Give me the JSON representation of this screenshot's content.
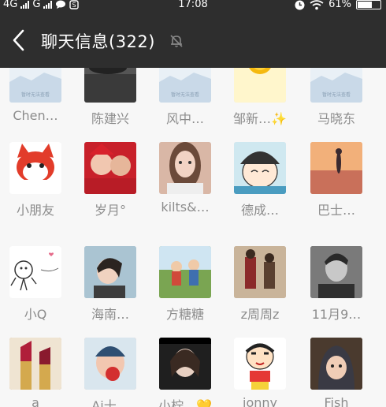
{
  "status_bar": {
    "network_left": "4G",
    "network_right": "G",
    "time": "17:08",
    "battery": "61%"
  },
  "header": {
    "title": "聊天信息(322)"
  },
  "placeholder_caption": "暂时无法查看",
  "rows": [
    {
      "members": [
        {
          "name": "Chen…",
          "avatar": "placeholder",
          "color": "#dbe6f0"
        },
        {
          "name": "陈建兴",
          "avatar": "photo-car",
          "color": "#3a3a3a"
        },
        {
          "name": "风中…",
          "avatar": "placeholder",
          "color": "#dbe6f0"
        },
        {
          "name": "邹新…✨",
          "avatar": "sun",
          "color": "#f6d64a"
        },
        {
          "name": "马晓东",
          "avatar": "placeholder",
          "color": "#dbe6f0"
        }
      ]
    },
    {
      "members": [
        {
          "name": "小朋友",
          "avatar": "fox-cartoon",
          "color": "#e23c2a"
        },
        {
          "name": "岁月°",
          "avatar": "couple-photo",
          "color": "#c8202a"
        },
        {
          "name": "kilts&…",
          "avatar": "girl-portrait",
          "color": "#d9b7a6"
        },
        {
          "name": "德成…",
          "avatar": "boy-cartoon",
          "color": "#5ab0c8"
        },
        {
          "name": "巴士…",
          "avatar": "sunset-girl",
          "color": "#e8a06a"
        }
      ]
    },
    {
      "members": [
        {
          "name": "小Q",
          "avatar": "doodle",
          "color": "#ffffff"
        },
        {
          "name": "海南…",
          "avatar": "woman-profile",
          "color": "#9fb7c4"
        },
        {
          "name": "方糖糖",
          "avatar": "kids-outdoor",
          "color": "#8fb86a"
        },
        {
          "name": "z周周z",
          "avatar": "couple-street",
          "color": "#b09880"
        },
        {
          "name": "11月9…",
          "avatar": "man-bw",
          "color": "#5c5c5c"
        }
      ]
    },
    {
      "members": [
        {
          "name": "a",
          "avatar": "lipstick",
          "color": "#c8a070"
        },
        {
          "name": "Ai十…",
          "avatar": "baby-apple",
          "color": "#e8b0a0"
        },
        {
          "name": "小柠…💛",
          "avatar": "woman-dark",
          "color": "#2a2a2a"
        },
        {
          "name": "jonny",
          "avatar": "shinchan",
          "color": "#ffffff"
        },
        {
          "name": "Fish",
          "avatar": "child-hood",
          "color": "#5a4a3a"
        }
      ]
    }
  ]
}
